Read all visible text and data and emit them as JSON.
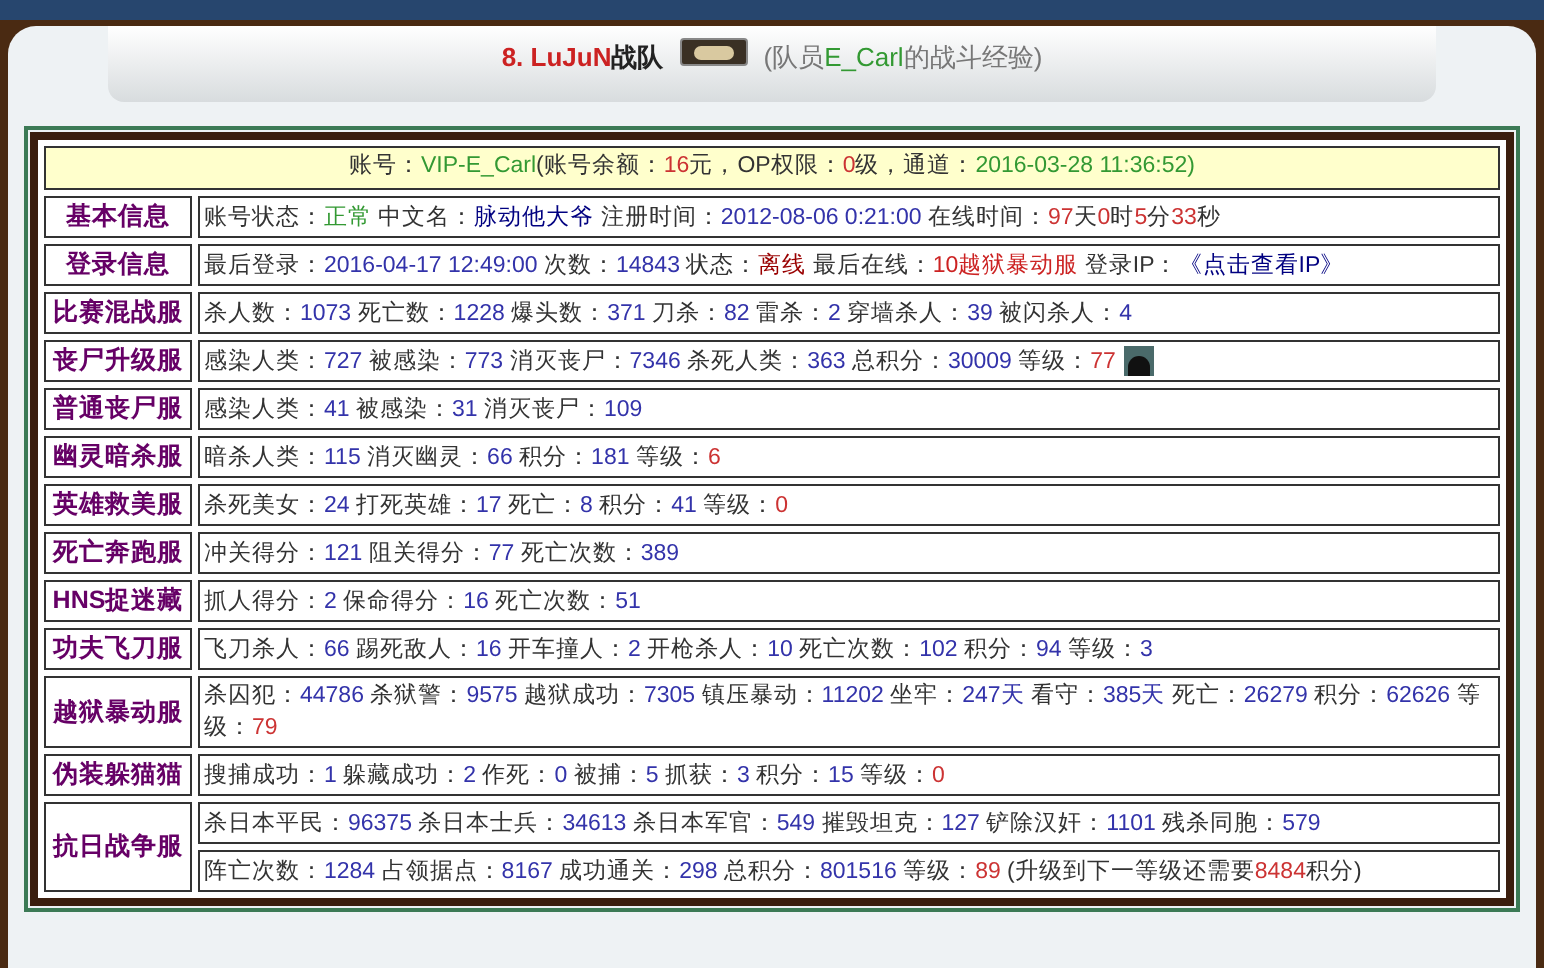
{
  "header": {
    "team": [
      {
        "text": "8. LuJuN",
        "color": "#cc2222"
      },
      {
        "text": "战队",
        "color": "#222222"
      }
    ],
    "member": [
      {
        "text": "(队员",
        "color": "#777777"
      },
      {
        "text": "E_Carl",
        "color": "#339933"
      },
      {
        "text": "的战斗经验)",
        "color": "#777777"
      }
    ]
  },
  "summary": [
    {
      "text": "账号：",
      "color": "#333333"
    },
    {
      "text": "VIP-E_Carl",
      "color": "#339933"
    },
    {
      "text": "(账号余额：",
      "color": "#333333"
    },
    {
      "text": "16",
      "color": "#cc3333"
    },
    {
      "text": "元，OP权限：",
      "color": "#333333"
    },
    {
      "text": "0",
      "color": "#cc3333"
    },
    {
      "text": "级，通道：",
      "color": "#333333"
    },
    {
      "text": "2016-03-28 11:36:52)",
      "color": "#339933"
    }
  ],
  "sections": [
    {
      "name": "基本信息",
      "lines": [
        [
          {
            "text": "账号状态：",
            "color": "#333333"
          },
          {
            "text": "正常",
            "color": "#339933"
          },
          {
            "text": " 中文名：",
            "color": "#333333"
          },
          {
            "text": "脉动他大爷",
            "color": "#000080"
          },
          {
            "text": " 注册时间：",
            "color": "#333333"
          },
          {
            "text": "2012-08-06 0:21:00",
            "color": "#3333aa"
          },
          {
            "text": " 在线时间：",
            "color": "#333333"
          },
          {
            "text": "97",
            "color": "#cc3333"
          },
          {
            "text": "天",
            "color": "#333333"
          },
          {
            "text": "0",
            "color": "#cc3333"
          },
          {
            "text": "时",
            "color": "#333333"
          },
          {
            "text": "5",
            "color": "#cc3333"
          },
          {
            "text": "分",
            "color": "#333333"
          },
          {
            "text": "33",
            "color": "#cc3333"
          },
          {
            "text": "秒",
            "color": "#333333"
          }
        ]
      ]
    },
    {
      "name": "登录信息",
      "lines": [
        [
          {
            "text": "最后登录：",
            "color": "#333333"
          },
          {
            "text": "2016-04-17 12:49:00",
            "color": "#3333aa"
          },
          {
            "text": " 次数：",
            "color": "#333333"
          },
          {
            "text": "14843",
            "color": "#3333aa"
          },
          {
            "text": " 状态：",
            "color": "#333333"
          },
          {
            "text": "离线",
            "color": "#990000"
          },
          {
            "text": " 最后在线：",
            "color": "#333333"
          },
          {
            "text": "10越狱暴动服",
            "color": "#cc2222"
          },
          {
            "text": " 登录IP：",
            "color": "#333333"
          },
          {
            "text": "《点击查看IP》",
            "color": "#000080"
          }
        ]
      ]
    },
    {
      "name": "比赛混战服",
      "lines": [
        [
          {
            "text": "杀人数：",
            "color": "#333333"
          },
          {
            "text": "1073",
            "color": "#3333aa"
          },
          {
            "text": " 死亡数：",
            "color": "#333333"
          },
          {
            "text": "1228",
            "color": "#3333aa"
          },
          {
            "text": " 爆头数：",
            "color": "#333333"
          },
          {
            "text": "371",
            "color": "#3333aa"
          },
          {
            "text": " 刀杀：",
            "color": "#333333"
          },
          {
            "text": "82",
            "color": "#3333aa"
          },
          {
            "text": " 雷杀：",
            "color": "#333333"
          },
          {
            "text": "2",
            "color": "#3333aa"
          },
          {
            "text": " 穿墙杀人：",
            "color": "#333333"
          },
          {
            "text": "39",
            "color": "#3333aa"
          },
          {
            "text": " 被闪杀人：",
            "color": "#333333"
          },
          {
            "text": "4",
            "color": "#3333aa"
          }
        ]
      ]
    },
    {
      "name": "丧尸升级服",
      "avatar": true,
      "lines": [
        [
          {
            "text": "感染人类：",
            "color": "#333333"
          },
          {
            "text": "727",
            "color": "#3333aa"
          },
          {
            "text": " 被感染：",
            "color": "#333333"
          },
          {
            "text": "773",
            "color": "#3333aa"
          },
          {
            "text": " 消灭丧尸：",
            "color": "#333333"
          },
          {
            "text": "7346",
            "color": "#3333aa"
          },
          {
            "text": " 杀死人类：",
            "color": "#333333"
          },
          {
            "text": "363",
            "color": "#3333aa"
          },
          {
            "text": " 总积分：",
            "color": "#333333"
          },
          {
            "text": "30009",
            "color": "#3333aa"
          },
          {
            "text": " 等级：",
            "color": "#333333"
          },
          {
            "text": "77",
            "color": "#cc3333"
          }
        ]
      ]
    },
    {
      "name": "普通丧尸服",
      "lines": [
        [
          {
            "text": "感染人类：",
            "color": "#333333"
          },
          {
            "text": "41",
            "color": "#3333aa"
          },
          {
            "text": " 被感染：",
            "color": "#333333"
          },
          {
            "text": "31",
            "color": "#3333aa"
          },
          {
            "text": " 消灭丧尸：",
            "color": "#333333"
          },
          {
            "text": "109",
            "color": "#3333aa"
          }
        ]
      ]
    },
    {
      "name": "幽灵暗杀服",
      "lines": [
        [
          {
            "text": "暗杀人类：",
            "color": "#333333"
          },
          {
            "text": "115",
            "color": "#3333aa"
          },
          {
            "text": " 消灭幽灵：",
            "color": "#333333"
          },
          {
            "text": "66",
            "color": "#3333aa"
          },
          {
            "text": " 积分：",
            "color": "#333333"
          },
          {
            "text": "181",
            "color": "#3333aa"
          },
          {
            "text": " 等级：",
            "color": "#333333"
          },
          {
            "text": "6",
            "color": "#cc3333"
          }
        ]
      ]
    },
    {
      "name": "英雄救美服",
      "lines": [
        [
          {
            "text": "杀死美女：",
            "color": "#333333"
          },
          {
            "text": "24",
            "color": "#3333aa"
          },
          {
            "text": " 打死英雄：",
            "color": "#333333"
          },
          {
            "text": "17",
            "color": "#3333aa"
          },
          {
            "text": " 死亡：",
            "color": "#333333"
          },
          {
            "text": "8",
            "color": "#3333aa"
          },
          {
            "text": " 积分：",
            "color": "#333333"
          },
          {
            "text": "41",
            "color": "#3333aa"
          },
          {
            "text": " 等级：",
            "color": "#333333"
          },
          {
            "text": "0",
            "color": "#cc3333"
          }
        ]
      ]
    },
    {
      "name": "死亡奔跑服",
      "lines": [
        [
          {
            "text": "冲关得分：",
            "color": "#333333"
          },
          {
            "text": "121",
            "color": "#3333aa"
          },
          {
            "text": " 阻关得分：",
            "color": "#333333"
          },
          {
            "text": "77",
            "color": "#3333aa"
          },
          {
            "text": " 死亡次数：",
            "color": "#333333"
          },
          {
            "text": "389",
            "color": "#3333aa"
          }
        ]
      ]
    },
    {
      "name": "HNS捉迷藏",
      "lines": [
        [
          {
            "text": "抓人得分：",
            "color": "#333333"
          },
          {
            "text": "2",
            "color": "#3333aa"
          },
          {
            "text": " 保命得分：",
            "color": "#333333"
          },
          {
            "text": "16",
            "color": "#3333aa"
          },
          {
            "text": " 死亡次数：",
            "color": "#333333"
          },
          {
            "text": "51",
            "color": "#3333aa"
          }
        ]
      ]
    },
    {
      "name": "功夫飞刀服",
      "lines": [
        [
          {
            "text": "飞刀杀人：",
            "color": "#333333"
          },
          {
            "text": "66",
            "color": "#3333aa"
          },
          {
            "text": " 踢死敌人：",
            "color": "#333333"
          },
          {
            "text": "16",
            "color": "#3333aa"
          },
          {
            "text": " 开车撞人：",
            "color": "#333333"
          },
          {
            "text": "2",
            "color": "#3333aa"
          },
          {
            "text": " 开枪杀人：",
            "color": "#333333"
          },
          {
            "text": "10",
            "color": "#3333aa"
          },
          {
            "text": " 死亡次数：",
            "color": "#333333"
          },
          {
            "text": "102",
            "color": "#3333aa"
          },
          {
            "text": " 积分：",
            "color": "#333333"
          },
          {
            "text": "94",
            "color": "#3333aa"
          },
          {
            "text": " 等级：",
            "color": "#333333"
          },
          {
            "text": "3",
            "color": "#3333aa"
          }
        ]
      ]
    },
    {
      "name": "越狱暴动服",
      "lines": [
        [
          {
            "text": "杀囚犯：",
            "color": "#333333"
          },
          {
            "text": "44786",
            "color": "#3333aa"
          },
          {
            "text": " 杀狱警：",
            "color": "#333333"
          },
          {
            "text": "9575",
            "color": "#3333aa"
          },
          {
            "text": " 越狱成功：",
            "color": "#333333"
          },
          {
            "text": "7305",
            "color": "#3333aa"
          },
          {
            "text": " 镇压暴动：",
            "color": "#333333"
          },
          {
            "text": "11202",
            "color": "#3333aa"
          },
          {
            "text": " 坐牢：",
            "color": "#333333"
          },
          {
            "text": "247天",
            "color": "#3333aa"
          },
          {
            "text": " 看守：",
            "color": "#333333"
          },
          {
            "text": "385天",
            "color": "#3333aa"
          },
          {
            "text": " 死亡：",
            "color": "#333333"
          },
          {
            "text": "26279",
            "color": "#3333aa"
          },
          {
            "text": " 积分：",
            "color": "#333333"
          },
          {
            "text": "62626",
            "color": "#3333aa"
          },
          {
            "text": " 等级：",
            "color": "#333333"
          },
          {
            "text": "79",
            "color": "#cc3333"
          }
        ]
      ]
    },
    {
      "name": "伪装躲猫猫",
      "lines": [
        [
          {
            "text": "搜捕成功：",
            "color": "#333333"
          },
          {
            "text": "1",
            "color": "#3333aa"
          },
          {
            "text": " 躲藏成功：",
            "color": "#333333"
          },
          {
            "text": "2",
            "color": "#3333aa"
          },
          {
            "text": " 作死：",
            "color": "#333333"
          },
          {
            "text": "0",
            "color": "#3333aa"
          },
          {
            "text": " 被捕：",
            "color": "#333333"
          },
          {
            "text": "5",
            "color": "#3333aa"
          },
          {
            "text": " 抓获：",
            "color": "#333333"
          },
          {
            "text": "3",
            "color": "#3333aa"
          },
          {
            "text": " 积分：",
            "color": "#333333"
          },
          {
            "text": "15",
            "color": "#3333aa"
          },
          {
            "text": " 等级：",
            "color": "#333333"
          },
          {
            "text": "0",
            "color": "#cc3333"
          }
        ]
      ]
    },
    {
      "name": "抗日战争服",
      "lines": [
        [
          {
            "text": "杀日本平民：",
            "color": "#333333"
          },
          {
            "text": "96375",
            "color": "#3333aa"
          },
          {
            "text": " 杀日本士兵：",
            "color": "#333333"
          },
          {
            "text": "34613",
            "color": "#3333aa"
          },
          {
            "text": " 杀日本军官：",
            "color": "#333333"
          },
          {
            "text": "549",
            "color": "#3333aa"
          },
          {
            "text": " 摧毁坦克：",
            "color": "#333333"
          },
          {
            "text": "127",
            "color": "#3333aa"
          },
          {
            "text": " 铲除汉奸：",
            "color": "#333333"
          },
          {
            "text": "1101",
            "color": "#3333aa"
          },
          {
            "text": " 残杀同胞：",
            "color": "#333333"
          },
          {
            "text": "579",
            "color": "#3333aa"
          }
        ],
        [
          {
            "text": "阵亡次数：",
            "color": "#333333"
          },
          {
            "text": "1284",
            "color": "#3333aa"
          },
          {
            "text": " 占领据点：",
            "color": "#333333"
          },
          {
            "text": "8167",
            "color": "#3333aa"
          },
          {
            "text": " 成功通关：",
            "color": "#333333"
          },
          {
            "text": "298",
            "color": "#3333aa"
          },
          {
            "text": " 总积分：",
            "color": "#333333"
          },
          {
            "text": "801516",
            "color": "#3333aa"
          },
          {
            "text": " 等级：",
            "color": "#333333"
          },
          {
            "text": "89",
            "color": "#cc3333"
          },
          {
            "text": " (升级到下一等级还需要",
            "color": "#333333"
          },
          {
            "text": "8484",
            "color": "#cc3333"
          },
          {
            "text": "积分)",
            "color": "#333333"
          }
        ]
      ]
    }
  ]
}
